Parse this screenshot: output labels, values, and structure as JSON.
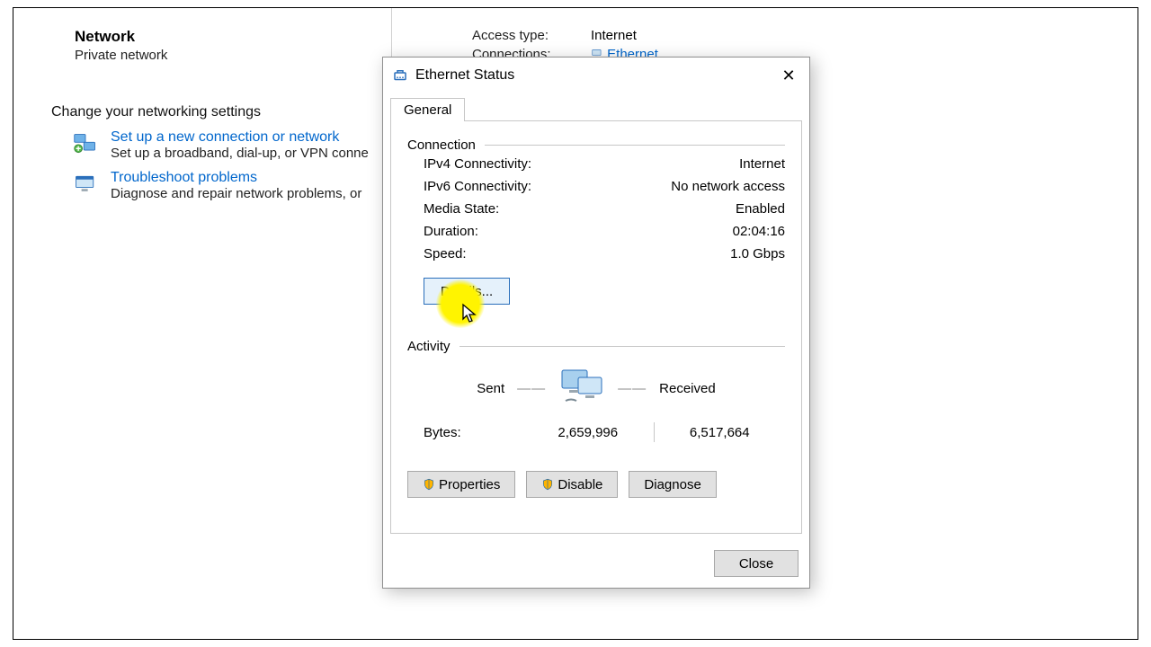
{
  "bg": {
    "network_heading": "Network",
    "network_sub": "Private network",
    "section_title": "Change your networking settings",
    "item1_link": "Set up a new connection or network",
    "item1_desc": "Set up a broadband, dial-up, or VPN conne",
    "item2_link": "Troubleshoot problems",
    "item2_desc": "Diagnose and repair network problems, or",
    "access_type_label": "Access type:",
    "access_type_value": "Internet",
    "connections_label": "Connections:",
    "connections_value": "Ethernet"
  },
  "dialog": {
    "title": "Ethernet Status",
    "tab_general": "General",
    "group_connection": "Connection",
    "fields": {
      "ipv4_l": "IPv4 Connectivity:",
      "ipv4_v": "Internet",
      "ipv6_l": "IPv6 Connectivity:",
      "ipv6_v": "No network access",
      "media_l": "Media State:",
      "media_v": "Enabled",
      "dur_l": "Duration:",
      "dur_v": "02:04:16",
      "speed_l": "Speed:",
      "speed_v": "1.0 Gbps"
    },
    "details_btn": "Details...",
    "group_activity": "Activity",
    "sent_label": "Sent",
    "received_label": "Received",
    "bytes_label": "Bytes:",
    "bytes_sent": "2,659,996",
    "bytes_received": "6,517,664",
    "btn_properties": "Properties",
    "btn_disable": "Disable",
    "btn_diagnose": "Diagnose",
    "btn_close": "Close"
  }
}
